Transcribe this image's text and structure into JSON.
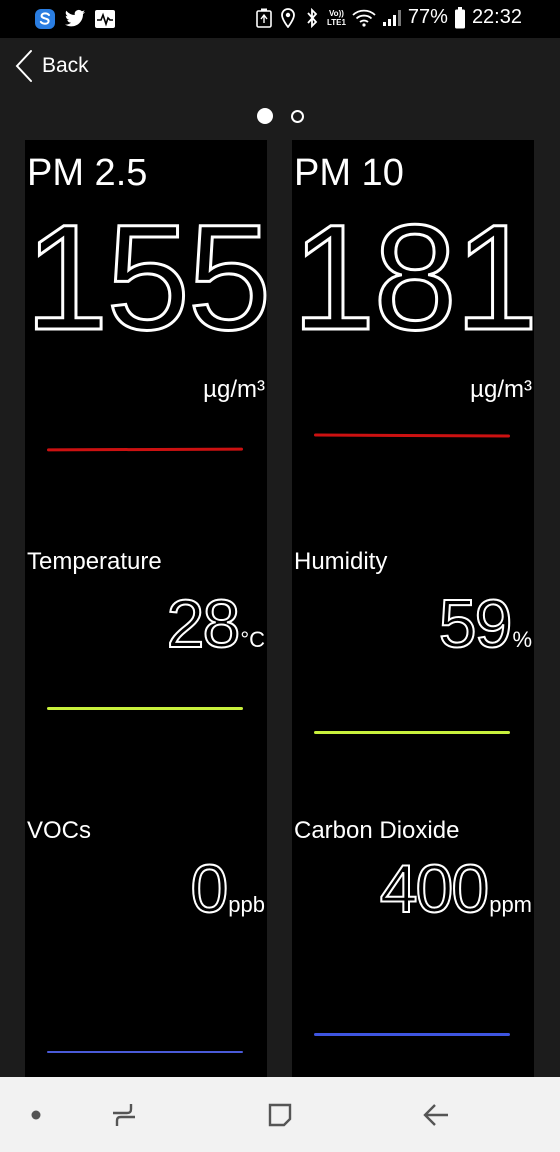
{
  "status_bar": {
    "battery_percent": "77%",
    "time": "22:32",
    "volte_label_top": "Vo))",
    "volte_label_bottom": "LTE1",
    "left_icons": [
      "s-logo-icon",
      "twitter-icon",
      "activity-icon"
    ],
    "right_icons": [
      "recycle-icon",
      "location-icon",
      "bluetooth-icon",
      "wifi-icon",
      "signal-icon",
      "battery-icon"
    ]
  },
  "header": {
    "back_label": "Back"
  },
  "pager": {
    "pages": 2,
    "active": 0
  },
  "cards": {
    "pm25": {
      "title": "PM 2.5",
      "value": "155",
      "unit": "µg/m³",
      "line_color": "#cc1111"
    },
    "pm10": {
      "title": "PM 10",
      "value": "181",
      "unit": "µg/m³",
      "line_color": "#cc1111"
    },
    "temperature": {
      "title": "Temperature",
      "value": "28",
      "unit": "°C",
      "line_color": "#c8f03c"
    },
    "humidity": {
      "title": "Humidity",
      "value": "59",
      "unit": "%",
      "line_color": "#c8f03c"
    },
    "vocs": {
      "title": "VOCs",
      "value": "0",
      "unit": "ppb",
      "line_color": "#4a5ad8"
    },
    "co2": {
      "title": "Carbon Dioxide",
      "value": "400",
      "unit": "ppm",
      "line_color": "#3e55e0"
    }
  },
  "nav_bar": {
    "buttons": [
      "recent-dot-icon",
      "recents-icon",
      "home-icon",
      "back-arrow-icon"
    ],
    "background": "#f2f2f2"
  }
}
